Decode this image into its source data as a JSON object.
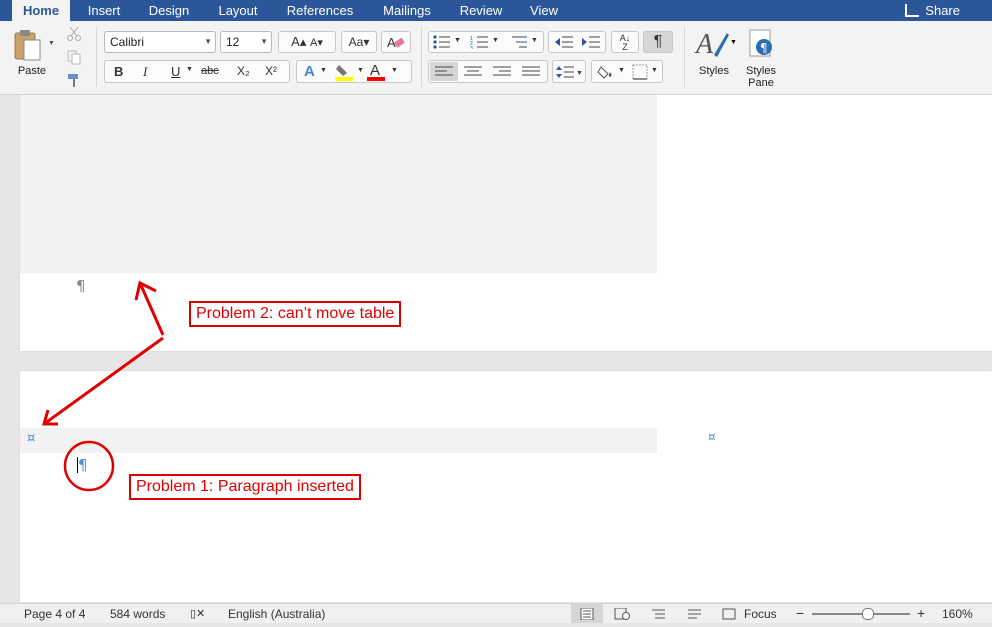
{
  "tabs": [
    "Home",
    "Insert",
    "Design",
    "Layout",
    "References",
    "Mailings",
    "Review",
    "View"
  ],
  "share_label": "Share",
  "ribbon": {
    "paste_label": "Paste",
    "font_name": "Calibri",
    "font_size": "12",
    "bold": "B",
    "italic": "I",
    "underline": "U",
    "strikethrough": "abc",
    "subscript": "X₂",
    "superscript": "X²",
    "font_color_letter": "A",
    "styles_label": "Styles",
    "styles_pane_label": "Styles Pane",
    "highlight_color": "#ffff00",
    "font_color": "#ff0000"
  },
  "annotations": {
    "problem2": "Problem 2: can’t move table",
    "problem1": "Problem 1: Paragraph inserted"
  },
  "glyphs": {
    "pilcrow": "¶",
    "cell_marker": "¤"
  },
  "status": {
    "page": "Page 4 of 4",
    "words": "584 words",
    "language": "English (Australia)",
    "focus": "Focus",
    "zoom_minus": "−",
    "zoom_plus": "+",
    "zoom": "160%"
  }
}
